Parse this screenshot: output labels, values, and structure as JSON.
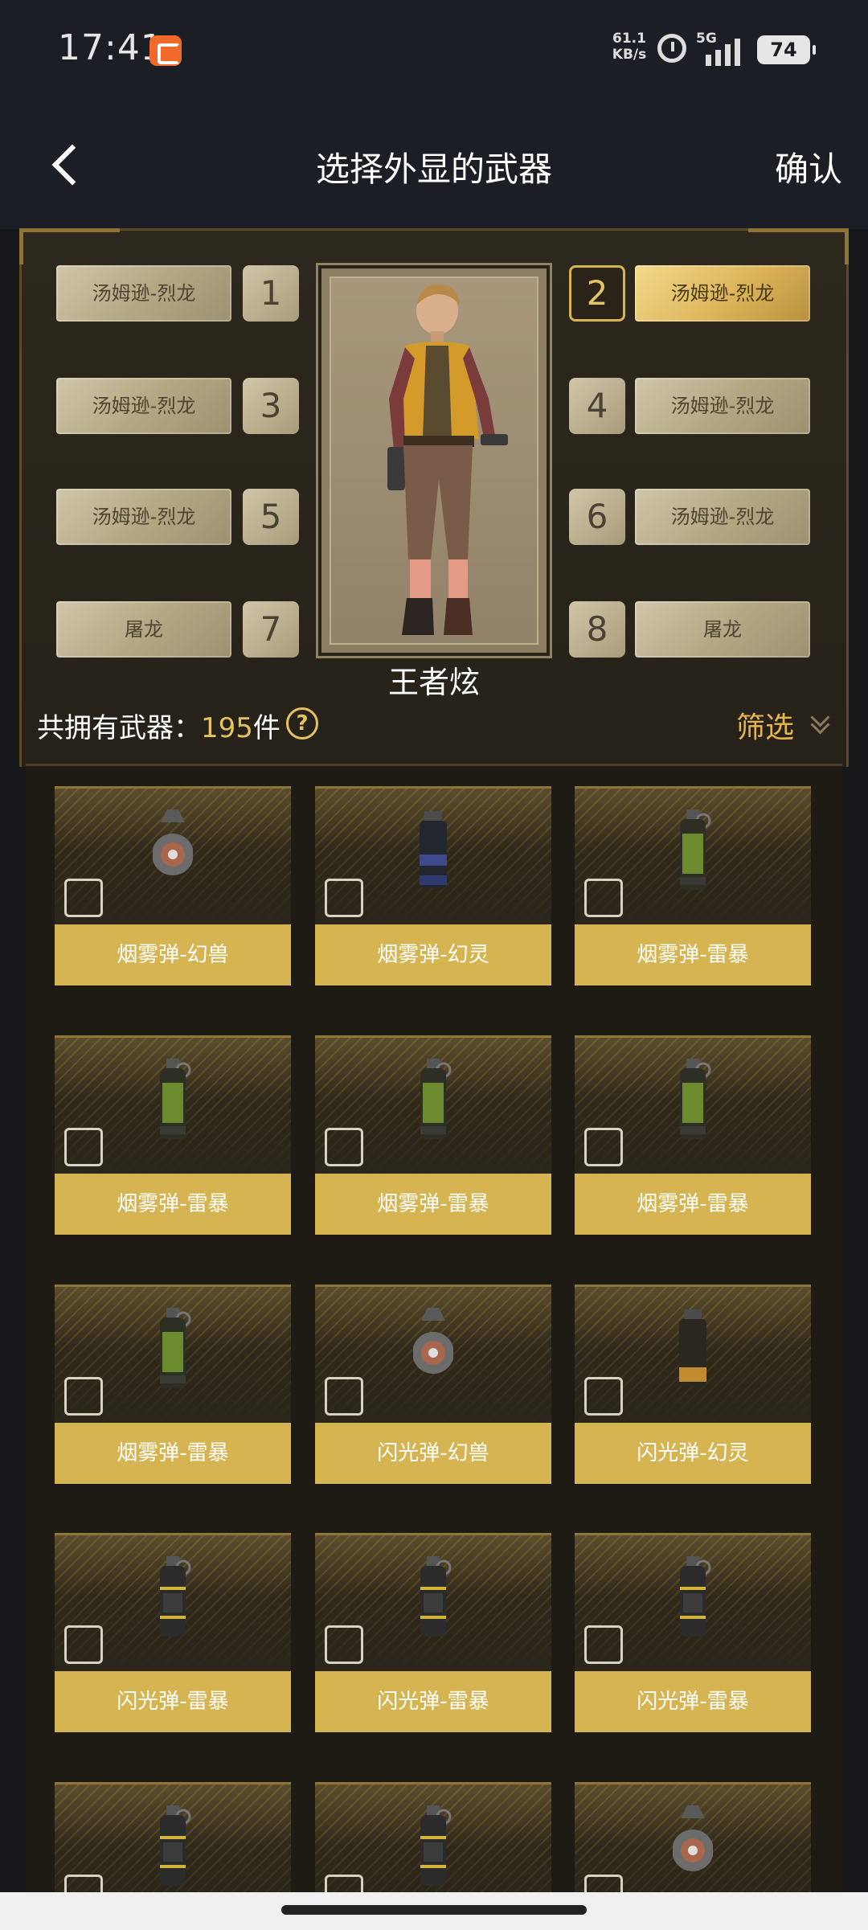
{
  "status_bar": {
    "time": "17:41",
    "net_speed_value": "61.1",
    "net_speed_unit": "KB/s",
    "network": "5G",
    "battery": "74"
  },
  "header": {
    "title": "选择外显的武器",
    "confirm_label": "确认"
  },
  "loadout": {
    "slots": [
      {
        "num": "1",
        "weapon": "汤姆逊-烈龙",
        "active": false
      },
      {
        "num": "2",
        "weapon": "汤姆逊-烈龙",
        "active": true
      },
      {
        "num": "3",
        "weapon": "汤姆逊-烈龙",
        "active": false
      },
      {
        "num": "4",
        "weapon": "汤姆逊-烈龙",
        "active": false
      },
      {
        "num": "5",
        "weapon": "汤姆逊-烈龙",
        "active": false
      },
      {
        "num": "6",
        "weapon": "汤姆逊-烈龙",
        "active": false
      },
      {
        "num": "7",
        "weapon": "屠龙",
        "active": false
      },
      {
        "num": "8",
        "weapon": "屠龙",
        "active": false
      }
    ],
    "character_name": "王者炫"
  },
  "inventory": {
    "owned_prefix": "共拥有武器：",
    "owned_count": "195",
    "owned_suffix": "件",
    "help_glyph": "?",
    "filter_label": "筛选",
    "items": [
      {
        "name": "烟雾弹-幻兽",
        "icon": "grenade-orb-icon"
      },
      {
        "name": "烟雾弹-幻灵",
        "icon": "grenade-canister-blue-icon"
      },
      {
        "name": "烟雾弹-雷暴",
        "icon": "grenade-green-icon"
      },
      {
        "name": "烟雾弹-雷暴",
        "icon": "grenade-green-icon"
      },
      {
        "name": "烟雾弹-雷暴",
        "icon": "grenade-green-icon"
      },
      {
        "name": "烟雾弹-雷暴",
        "icon": "grenade-green-icon"
      },
      {
        "name": "烟雾弹-雷暴",
        "icon": "grenade-green-icon"
      },
      {
        "name": "闪光弹-幻兽",
        "icon": "grenade-orb-icon"
      },
      {
        "name": "闪光弹-幻灵",
        "icon": "grenade-canister-gold-icon"
      },
      {
        "name": "闪光弹-雷暴",
        "icon": "grenade-yellow-icon"
      },
      {
        "name": "闪光弹-雷暴",
        "icon": "grenade-yellow-icon"
      },
      {
        "name": "闪光弹-雷暴",
        "icon": "grenade-yellow-icon"
      },
      {
        "name": "",
        "icon": "grenade-yellow-icon"
      },
      {
        "name": "",
        "icon": "grenade-yellow-icon"
      },
      {
        "name": "",
        "icon": "grenade-orb-icon"
      }
    ]
  },
  "colors": {
    "accent_gold": "#e7c15d",
    "label_gold": "#d6b451",
    "background": "#15171b"
  }
}
